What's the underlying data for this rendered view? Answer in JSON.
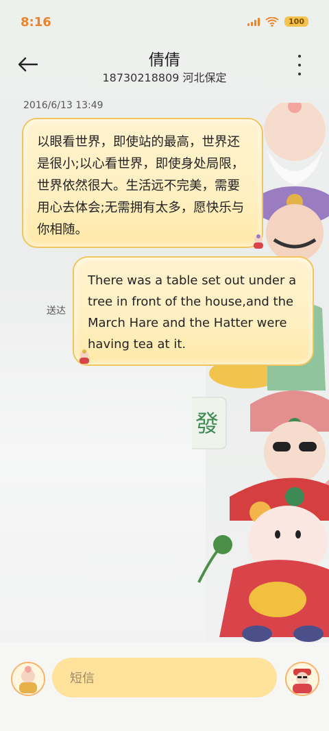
{
  "status_bar": {
    "time": "8:16",
    "battery": "100"
  },
  "header": {
    "contact_name": "倩倩",
    "contact_info": "18730218809 河北保定"
  },
  "conversation": {
    "timestamp": "2016/6/13 13:49",
    "incoming_message": "以眼看世界，即使站的最高，世界还是很小;以心看世界，即使身处局限，世界依然很大。生活远不完美，需要用心去体会;无需拥有太多，愿快乐与你相随。",
    "outgoing_message": "There was a table set out under a tree in front of the house,and the March Hare and the Hatter were having tea at it.",
    "outgoing_status": "送达"
  },
  "composer": {
    "placeholder": "短信"
  },
  "colors": {
    "accent": "#e8852a",
    "bubble_fill": "#fff0c2",
    "bubble_border": "#f2c45b",
    "input_fill": "#ffe39d"
  },
  "icons": [
    "back-arrow-icon",
    "more-vertical-icon",
    "signal-icon",
    "wifi-icon",
    "battery-icon",
    "sticker-icon",
    "avatar-icon",
    "emoji-sticker-icon"
  ]
}
